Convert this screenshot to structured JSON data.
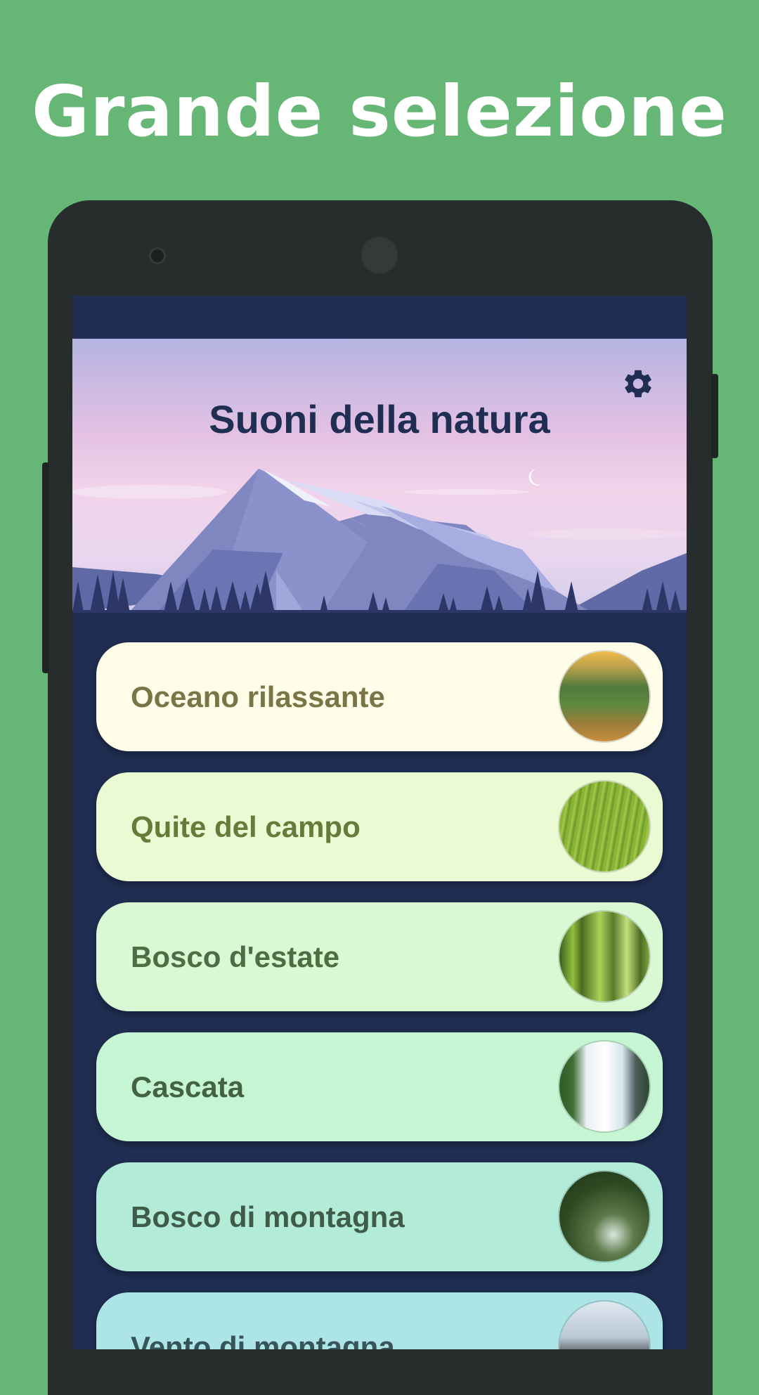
{
  "promo": {
    "title": "Grande selezione"
  },
  "app": {
    "title": "Suoni della natura",
    "settings_icon": "gear-icon"
  },
  "colors": {
    "background": "#66b776",
    "phone": "#272c2d",
    "screen": "#1f2e52"
  },
  "sounds": [
    {
      "label": "Oceano rilassante",
      "bg": "#fefee8",
      "fg": "#7a7447",
      "thumb": "ocean"
    },
    {
      "label": "Quite del campo",
      "bg": "#eafad2",
      "fg": "#667a3a",
      "thumb": "field"
    },
    {
      "label": "Bosco d'estate",
      "bg": "#d9f8d4",
      "fg": "#4f6d42",
      "thumb": "summer-forest"
    },
    {
      "label": "Cascata",
      "bg": "#c6f5d4",
      "fg": "#436244",
      "thumb": "waterfall"
    },
    {
      "label": "Bosco di montagna",
      "bg": "#b2ecd8",
      "fg": "#3f5c4b",
      "thumb": "mountain-forest"
    },
    {
      "label": "Vento di montagna",
      "bg": "#ade4e6",
      "fg": "#37545a",
      "thumb": "mountain-wind"
    }
  ]
}
